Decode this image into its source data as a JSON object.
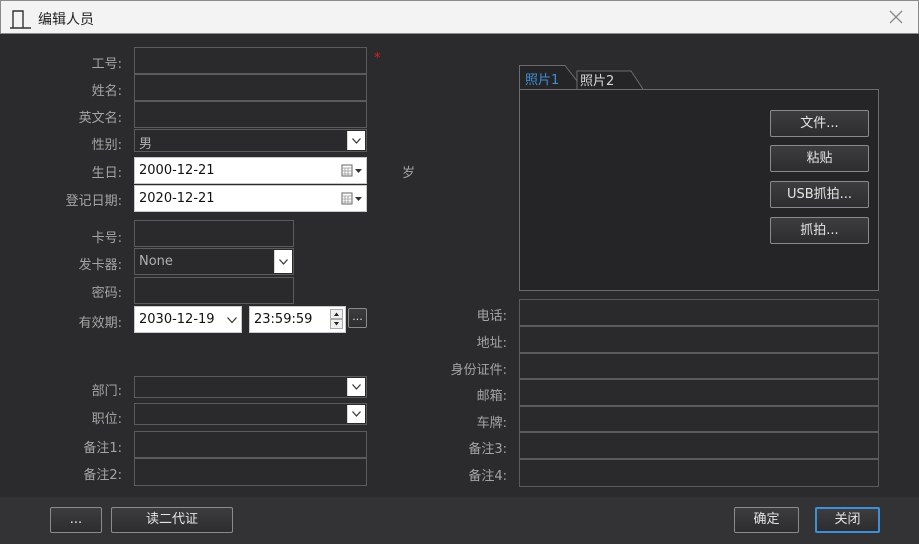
{
  "window": {
    "title": "编辑人员"
  },
  "labels": {
    "work_no": "工号:",
    "name": "姓名:",
    "english_name": "英文名:",
    "gender": "性别:",
    "birthday": "生日:",
    "register_date": "登记日期:",
    "card_no": "卡号:",
    "issuer": "发卡器:",
    "password": "密码:",
    "valid_until": "有效期:",
    "department": "部门:",
    "position": "职位:",
    "remark1": "备注1:",
    "remark2": "备注2:",
    "age_unit": "岁",
    "phone": "电话:",
    "address": "地址:",
    "id_card": "身份证件:",
    "email": "邮箱:",
    "plate": "车牌:",
    "remark3": "备注3:",
    "remark4": "备注4:"
  },
  "values": {
    "gender": "男",
    "birthday": "2000-12-21",
    "register_date": "2020-12-21",
    "issuer": "None",
    "valid_date": "2030-12-19",
    "valid_time": "23:59:59"
  },
  "required_mark": "*",
  "photo_tabs": [
    "照片1",
    "照片2"
  ],
  "photo_buttons": {
    "file": "文件...",
    "paste": "粘贴",
    "usb_capture": "USB抓拍...",
    "capture": "抓拍..."
  },
  "footer": {
    "more": "...",
    "read_id": "读二代证",
    "ok": "确定",
    "close": "关闭"
  },
  "ellipsis_button": "...",
  "colors": {
    "active_tab": "#3d8fd8",
    "required": "#e02020",
    "background": "#2b2b2d"
  }
}
